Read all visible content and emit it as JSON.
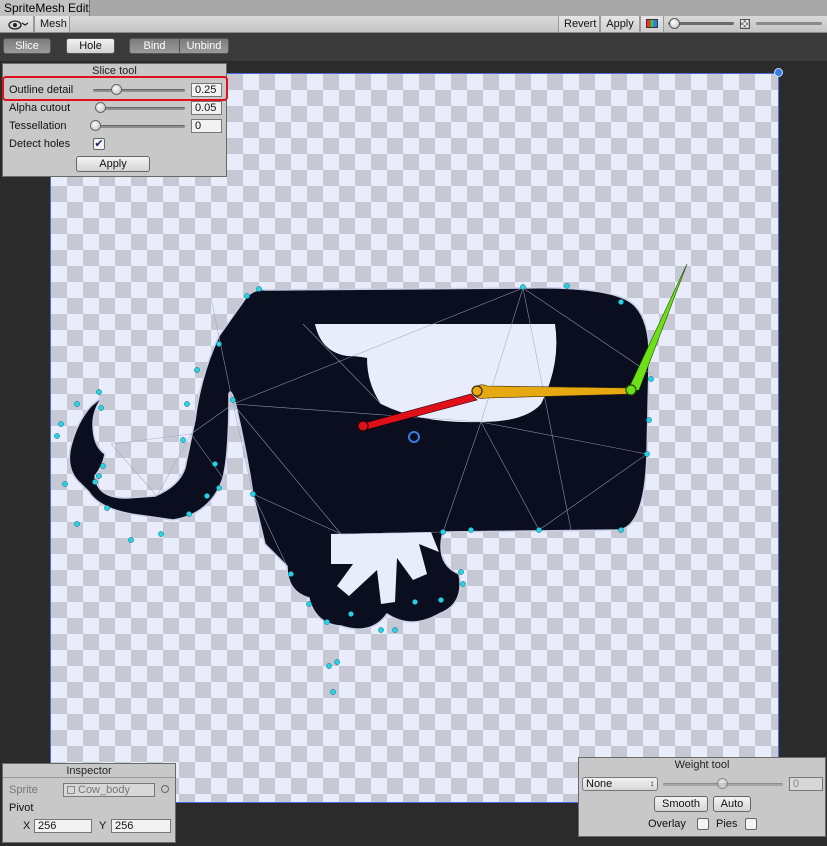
{
  "window": {
    "title": "SpriteMesh Editor"
  },
  "toolbar": {
    "view_icon": "eye-icon",
    "mesh_tab": "Mesh",
    "revert": "Revert",
    "apply": "Apply",
    "color_icon": "color-channel-icon",
    "alpha_icon": "alpha-checker-icon"
  },
  "tools": {
    "slice": "Slice",
    "hole": "Hole",
    "bind": "Bind",
    "unbind": "Unbind",
    "active": "slice"
  },
  "slice_tool": {
    "title": "Slice tool",
    "outline_detail": {
      "label": "Outline detail",
      "value": "0.25",
      "fraction": 0.25
    },
    "alpha_cutout": {
      "label": "Alpha cutout",
      "value": "0.05",
      "fraction": 0.05
    },
    "tessellation": {
      "label": "Tessellation",
      "value": "0",
      "fraction": 0.0
    },
    "detect_holes": {
      "label": "Detect holes",
      "checked": true
    },
    "apply": "Apply"
  },
  "inspector": {
    "title": "Inspector",
    "sprite_label": "Sprite",
    "sprite_value": "Cow_body",
    "pivot_label": "Pivot",
    "x_label": "X",
    "x_value": "256",
    "y_label": "Y",
    "y_value": "256"
  },
  "weight_tool": {
    "title": "Weight tool",
    "bone_select": "None",
    "weight_value": "0",
    "smooth": "Smooth",
    "auto": "Auto",
    "overlay_label": "Overlay",
    "pies_label": "Pies",
    "overlay_checked": false,
    "pies_checked": false
  },
  "colors": {
    "canvas_border": "#4a6fd8",
    "sprite_body": "#0b0e1e",
    "bone_red": "#e0101a",
    "bone_orange": "#e6a912",
    "bone_green": "#6ee016",
    "vertex": "#28d2e6",
    "highlight": "#e0101a"
  }
}
